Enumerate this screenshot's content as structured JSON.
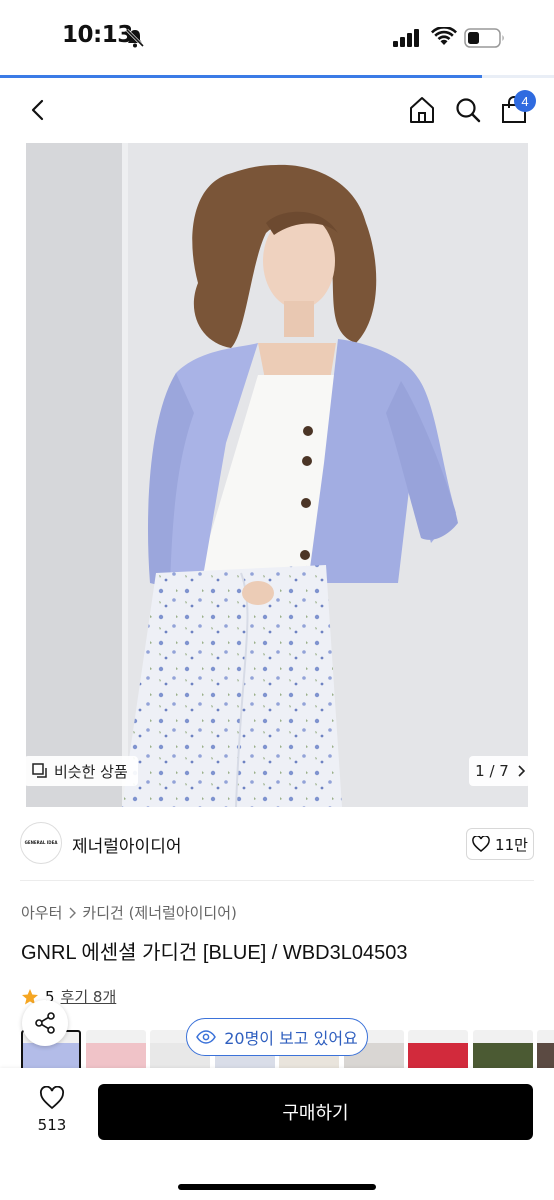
{
  "status_bar": {
    "time": "10:13",
    "page_load_progress": 0.87
  },
  "nav": {
    "cart_count": "4"
  },
  "hero": {
    "similar_label": "비슷한 상품",
    "page_indicator": "1 / 7"
  },
  "brand": {
    "logo_text": "GENERAL IDEA",
    "name": "제너럴아이디어",
    "likes": "11만"
  },
  "product": {
    "breadcrumb": [
      "아우터",
      "카디건 (제너럴아이디어)"
    ],
    "title": "GNRL 에센셜 가디건 [BLUE] / WBD3L04503",
    "rating": "5",
    "reviews": "후기 8개"
  },
  "live_viewers": "20명이 보고 있어요",
  "bottom": {
    "wish_count": "513",
    "buy_label": "구매하기"
  },
  "colors": {
    "accent": "#2f6be0",
    "cardigan": "#a9b3e6",
    "buy_button": "#000000"
  },
  "thumbnails": [
    {
      "color": "#b3bce8"
    },
    {
      "color": "#f0c3c8"
    },
    {
      "color": "#e8e8e8"
    },
    {
      "color": "#d9dde8"
    },
    {
      "color": "#e9e4dc"
    },
    {
      "color": "#d9d6d3"
    },
    {
      "color": "#d22a3c"
    },
    {
      "color": "#4b5a33"
    },
    {
      "color": "#5b4a42"
    },
    {
      "color": "#b33a2a"
    }
  ]
}
